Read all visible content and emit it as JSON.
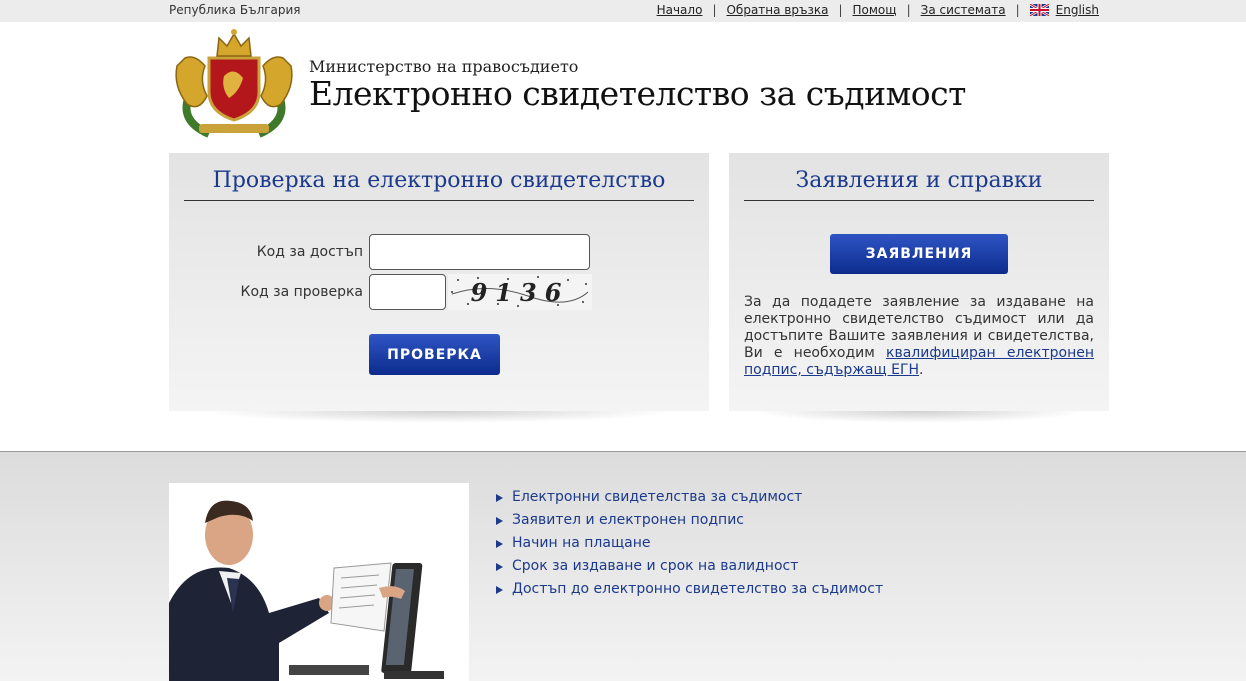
{
  "topbar": {
    "country": "Република България",
    "nav": [
      "Начало",
      "Обратна връзка",
      "Помощ",
      "За системата"
    ],
    "language": "English"
  },
  "header": {
    "ministry": "Министерство на правосъдието",
    "title": "Електронно свидетелство за съдимост"
  },
  "check_panel": {
    "title": "Проверка на електронно свидетелство",
    "access_code_label": "Код за достъп",
    "verify_code_label": "Код за проверка",
    "captcha_text": "9136",
    "button": "ПРОВЕРКА"
  },
  "apps_panel": {
    "title": "Заявления и справки",
    "button": "ЗАЯВЛЕНИЯ",
    "info_text": "За да подадете заявление за издаване на електронно свидетелство съдимост или да достъпите Вашите заявления и свидетелства, Ви е необходим",
    "info_link": "квалифициран електронен подпис, съдържащ ЕГН",
    "info_end": "."
  },
  "links": [
    "Електронни свидетелства за съдимост",
    "Заявител и електронен подпис",
    "Начин на плащане",
    "Срок за издаване и срок на валидност",
    "Достъп до електронно свидетелство за съдимост"
  ],
  "colors": {
    "accent": "#1c3a8c",
    "button_top": "#2f55c4",
    "button_bottom": "#0c2b8c"
  }
}
